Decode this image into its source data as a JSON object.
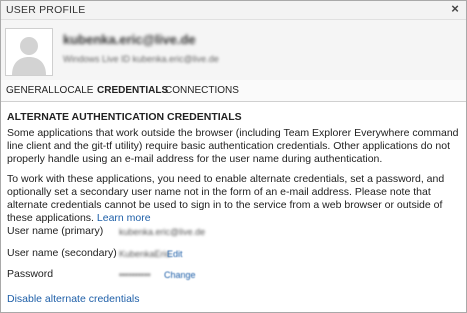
{
  "window": {
    "title": "USER PROFILE",
    "close_glyph": "×"
  },
  "user": {
    "email": "kubenka.eric@live.de",
    "account_line": "Windows Live ID kubenka.eric@live.de"
  },
  "tabs": [
    {
      "label": "GENERAL",
      "active": false
    },
    {
      "label": "LOCALE",
      "active": false
    },
    {
      "label": "CREDENTIALS",
      "active": true
    },
    {
      "label": "CONNECTIONS",
      "active": false
    }
  ],
  "credentials": {
    "heading": "ALTERNATE AUTHENTICATION CREDENTIALS",
    "intro": "Some applications that work outside the browser (including Team Explorer Everywhere command line client and the git-tf utility) require basic authentication credentials. Other applications do not properly handle using an e-mail address for the user name during authentication.",
    "instructions": "To work with these applications, you need to enable alternate credentials, set a password, and optionally set a secondary user name not in the form of an e-mail address. Please note that alternate credentials cannot be used to sign in to the service from a web browser or outside of these applications.",
    "learn_more": "Learn more",
    "fields": {
      "primary_label": "User name (primary)",
      "primary_value": "kubenka.eric@live.de",
      "secondary_label": "User name (secondary)",
      "secondary_value": "KubenkaEric",
      "secondary_action": "Edit",
      "password_label": "Password",
      "password_value": "••••••••••",
      "password_action": "Change"
    },
    "disable_link": "Disable alternate credentials"
  },
  "icons": {
    "avatar": "person-silhouette-icon",
    "close": "close-icon"
  }
}
